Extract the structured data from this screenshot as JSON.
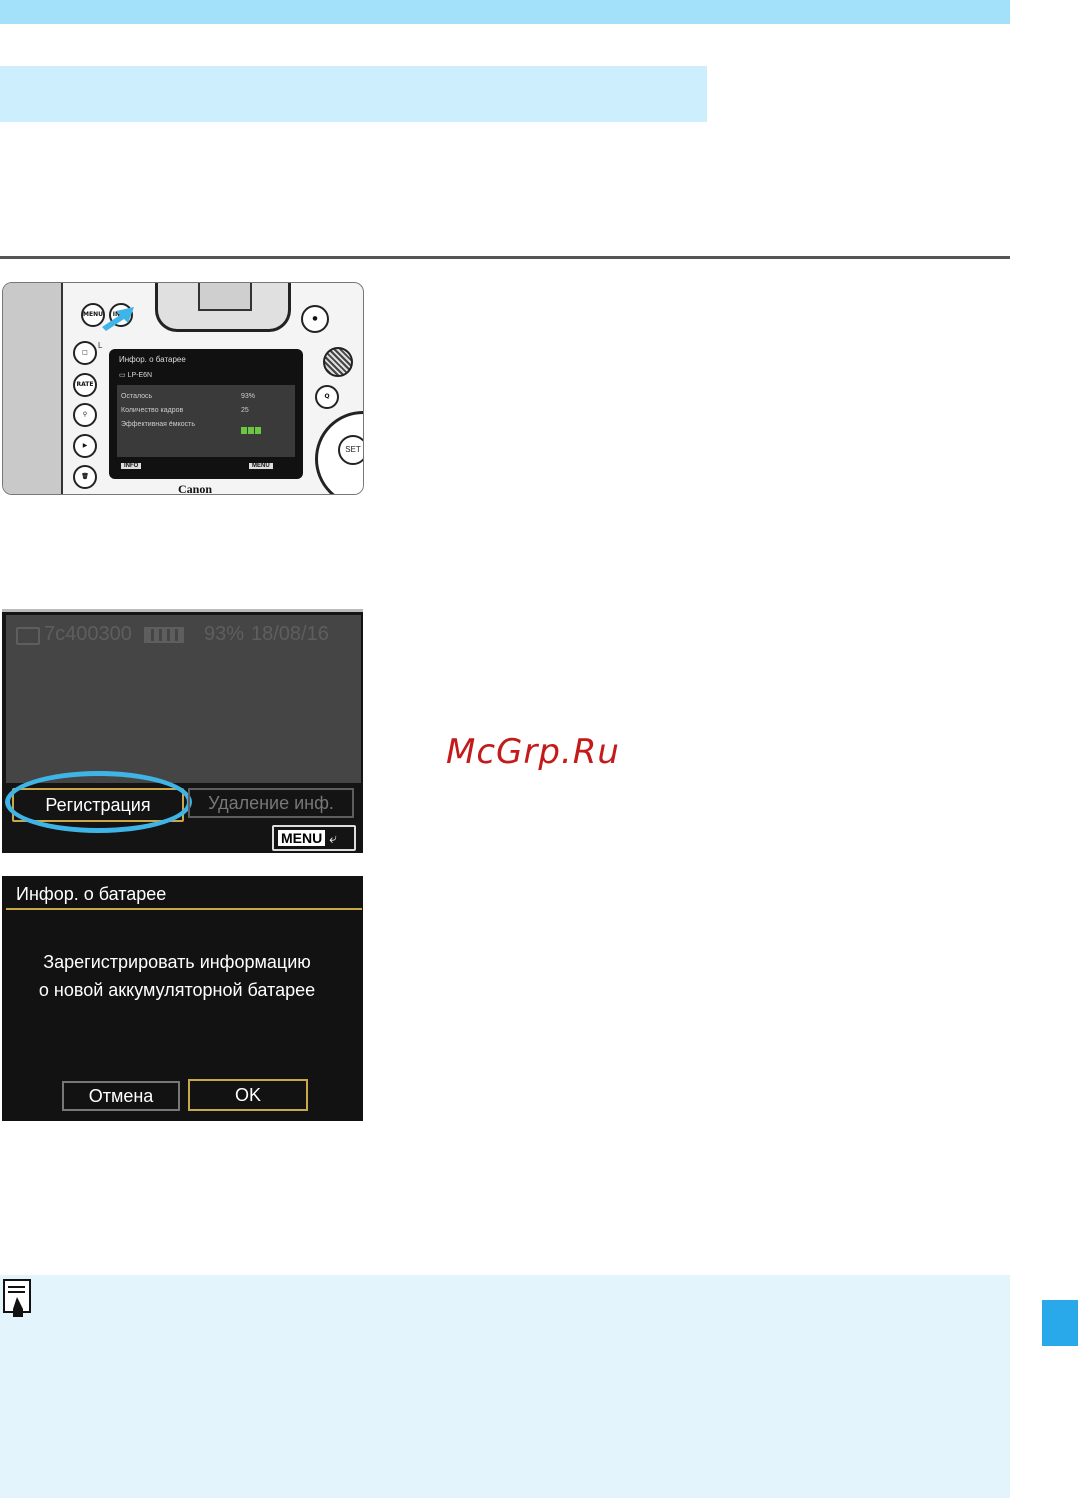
{
  "colors": {
    "accent_blue": "#29a9ea",
    "band_blue": "#cdeefc",
    "note_blue": "#e3f4fc",
    "highlight_ring": "#3fb4e6",
    "select_gold": "#c9a84a",
    "watermark_red": "#c41a1a"
  },
  "camera": {
    "buttons": [
      "MENU",
      "INFO",
      "RATE",
      "SET"
    ],
    "screen_title": "Инфор. о батарее",
    "battery_model": "LP-E6N",
    "rows": [
      {
        "label": "Осталось",
        "value": "93%"
      },
      {
        "label": "Количество кадров",
        "value": "25"
      },
      {
        "label": "Эффективная ёмкость",
        "value": ""
      }
    ],
    "info_label": "INFO",
    "menu_label": "MENU",
    "brand": "Canon"
  },
  "register": {
    "battery_id": "7c400300",
    "level": "93%",
    "date": "18/08/16",
    "register_label": "Регистрация",
    "delete_label": "Удаление инф.",
    "menu_label": "MENU"
  },
  "confirm": {
    "title": "Инфор. о батарее",
    "message_line1": "Зарегистрировать информацию",
    "message_line2": "о новой аккумуляторной батарее",
    "cancel_label": "Отмена",
    "ok_label": "OK"
  },
  "watermark": "McGrp.Ru"
}
